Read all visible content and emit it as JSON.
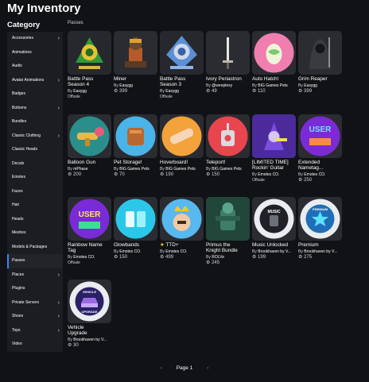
{
  "title": "My Inventory",
  "category_heading": "Category",
  "section_heading": "Passes",
  "sidebar": [
    {
      "label": "Accessories",
      "chevron": true
    },
    {
      "label": "Animations",
      "chevron": false
    },
    {
      "label": "Audio",
      "chevron": false
    },
    {
      "label": "Avatar Animations",
      "chevron": true
    },
    {
      "label": "Badges",
      "chevron": false
    },
    {
      "label": "Bottoms",
      "chevron": true
    },
    {
      "label": "Bundles",
      "chevron": false
    },
    {
      "label": "Classic Clothing",
      "chevron": true
    },
    {
      "label": "Classic Heads",
      "chevron": false
    },
    {
      "label": "Decals",
      "chevron": false
    },
    {
      "label": "Emotes",
      "chevron": false
    },
    {
      "label": "Faces",
      "chevron": false
    },
    {
      "label": "Hair",
      "chevron": false
    },
    {
      "label": "Heads",
      "chevron": false
    },
    {
      "label": "Meshes",
      "chevron": false
    },
    {
      "label": "Models & Packages",
      "chevron": false
    },
    {
      "label": "Passes",
      "chevron": false,
      "active": true
    },
    {
      "label": "Places",
      "chevron": true
    },
    {
      "label": "Plugins",
      "chevron": false
    },
    {
      "label": "Private Servers",
      "chevron": true
    },
    {
      "label": "Shoes",
      "chevron": true
    },
    {
      "label": "Tops",
      "chevron": true
    },
    {
      "label": "Video",
      "chevron": false
    }
  ],
  "items": [
    {
      "name": "Battle Pass\nSeason 4",
      "by": "By",
      "creator": "Easygg",
      "price": "",
      "note": "Offsale",
      "icon": "battle-pass-season-4-icon",
      "bg": "#26282e"
    },
    {
      "name": "Miner",
      "by": "By",
      "creator": "Easygg",
      "price": "399",
      "note": "",
      "icon": "miner-icon",
      "bg": "#2a2c31"
    },
    {
      "name": "Battle Pass\nSeason 3",
      "by": "By",
      "creator": "Easygg",
      "price": "",
      "note": "Offsale",
      "icon": "battle-pass-season-3-icon",
      "bg": "#26282e"
    },
    {
      "name": "Ivory Periastron",
      "by": "By",
      "creator": "@weeplexy",
      "price": "49",
      "note": "",
      "icon": "ivory-periastron-icon",
      "bg": "#2a2c31"
    },
    {
      "name": "Auto Hatch!",
      "by": "By",
      "creator": "BIG Games Pets",
      "price": "110",
      "note": "",
      "icon": "auto-hatch-icon",
      "bg": "#2a2c31"
    },
    {
      "name": "Grim Reaper",
      "by": "By",
      "creator": "Easygg",
      "price": "399",
      "note": "",
      "icon": "grim-reaper-icon",
      "bg": "#2a2c31"
    },
    {
      "name": "Balloon Gun",
      "by": "By",
      "creator": "mPhase",
      "price": "200",
      "note": "",
      "icon": "balloon-gun-icon",
      "bg": "#2a2c31"
    },
    {
      "name": "Pet Storage!",
      "by": "By",
      "creator": "BIG Games Pets",
      "price": "70",
      "note": "",
      "icon": "pet-storage-icon",
      "bg": "#2a2c31"
    },
    {
      "name": "Hoverboard!",
      "by": "By",
      "creator": "BIG Games Pets",
      "price": "190",
      "note": "",
      "icon": "hoverboard-icon",
      "bg": "#2a2c31"
    },
    {
      "name": "Teleport!",
      "by": "By",
      "creator": "BIG Games Pets",
      "price": "150",
      "note": "",
      "icon": "teleport-icon",
      "bg": "#2a2c31"
    },
    {
      "name": "[LIMITED TIME]\nRockin' Guitar",
      "by": "By",
      "creator": "Emotes CO.",
      "price": "",
      "note": "Offsale",
      "icon": "rockin-guitar-icon",
      "bg": "#2a2c31"
    },
    {
      "name": "Extended\nNametag...",
      "by": "By",
      "creator": "Emotes CO.",
      "price": "250",
      "note": "",
      "icon": "extended-nametag-icon",
      "bg": "#2a2c31"
    },
    {
      "name": "Rainbow Name\nTag",
      "by": "By",
      "creator": "Emotes CO.",
      "price": "",
      "note": "Offsale",
      "icon": "rainbow-name-tag-icon",
      "bg": "#2a2c31"
    },
    {
      "name": "Glowbands",
      "by": "By",
      "creator": "Emotes CO.",
      "price": "150",
      "note": "",
      "icon": "glowbands-icon",
      "bg": "#2a2c31"
    },
    {
      "name": "TTD+",
      "by": "By",
      "creator": "Emotes CO.",
      "price": "499",
      "note": "",
      "icon": "ttd-plus-icon",
      "bg": "#2a2c31",
      "star": true
    },
    {
      "name": "Primus the\nKnight Bundle",
      "by": "By",
      "creator": "ROLVe",
      "price": "245",
      "note": "",
      "icon": "primus-knight-icon",
      "bg": "#2a2c31"
    },
    {
      "name": "Music Unlocked",
      "by": "By",
      "creator": "Brookhaven by V...",
      "price": "199",
      "note": "",
      "icon": "music-unlocked-icon",
      "bg": "#2a2c31"
    },
    {
      "name": "Premium",
      "by": "By",
      "creator": "Brookhaven by V...",
      "price": "275",
      "note": "",
      "icon": "premium-icon",
      "bg": "#2a2c31"
    },
    {
      "name": "Vehicle\nUpgrade",
      "by": "By",
      "creator": "Brookhaven by V...",
      "price": "30",
      "note": "",
      "icon": "vehicle-upgrade-icon",
      "bg": "#2a2c31"
    }
  ],
  "thumb_text": {
    "user_a": "USER",
    "user_b": "USER",
    "music": "MUSIC",
    "premium": "PREMIUM",
    "vehicle_top": "VEHICLE",
    "vehicle_bottom": "UPGRADE"
  },
  "pager": {
    "prev": "‹",
    "label": "Page 1",
    "next": "›"
  },
  "colors": {
    "accent": "#3b82f6",
    "background": "#111216",
    "sidebar": "#1c1d22",
    "card": "#2a2c31"
  }
}
